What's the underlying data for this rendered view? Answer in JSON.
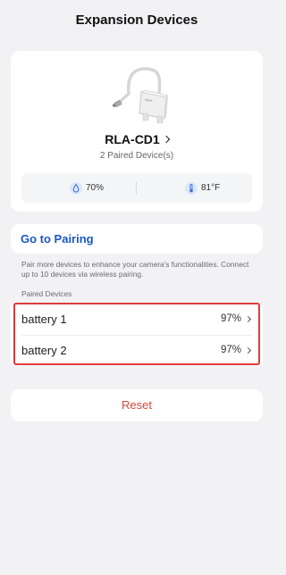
{
  "header": {
    "title": "Expansion Devices"
  },
  "device": {
    "image_icon": "hub-device-image",
    "name": "RLA-CD1",
    "paired_count": "2 Paired Device(s)",
    "humidity": "70%",
    "humidity_icon": "water-drop-icon",
    "temperature": "81°F",
    "temperature_icon": "thermometer-icon"
  },
  "pairing": {
    "link_label": "Go to Pairing",
    "description": "Pair more devices to enhance your camera's functionalities. Connect up to 10 devices via wireless pairing."
  },
  "paired_devices": {
    "heading": "Paired Devices",
    "items": [
      {
        "name": "battery 1",
        "value": "97%"
      },
      {
        "name": "battery 2",
        "value": "97%"
      }
    ]
  },
  "reset": {
    "label": "Reset"
  },
  "colors": {
    "accent": "#1a56c8",
    "danger": "#d9463a",
    "highlight": "#e03a3a",
    "background": "#f2f2f5",
    "icon_blue": "#3b74d8"
  }
}
